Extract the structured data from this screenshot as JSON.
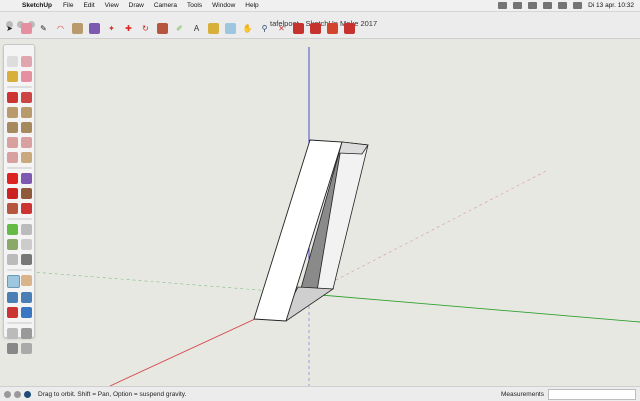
{
  "menubar": {
    "app": "SketchUp",
    "items": [
      "File",
      "Edit",
      "View",
      "Draw",
      "Camera",
      "Tools",
      "Window",
      "Help"
    ],
    "datetime": "Di 13 apr.  10:32"
  },
  "window": {
    "title": "tafelpoot - SketchUp Make 2017"
  },
  "status": {
    "text": "Drag to orbit. Shift = Pan, Option = suspend gravity.",
    "measurements_label": "Measurements"
  },
  "colors": {
    "axis_red": "#d44a4a",
    "axis_green": "#2fa12f",
    "axis_blue": "#3c3cc8",
    "model_face": "#ffffff",
    "model_inner": "#8a8a8a"
  }
}
